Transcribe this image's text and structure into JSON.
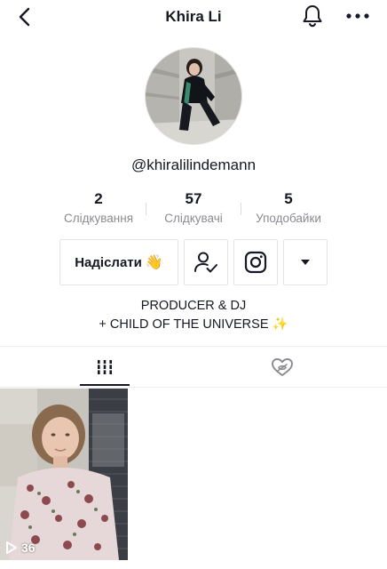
{
  "header": {
    "title": "Khira Li",
    "back_icon": "chevron-left-icon",
    "bell_icon": "bell-icon",
    "more_icon": "more-horizontal-icon"
  },
  "profile": {
    "username": "@khiralilindemann"
  },
  "stats": [
    {
      "value": "2",
      "label": "Слідкування"
    },
    {
      "value": "57",
      "label": "Слідкувачі"
    },
    {
      "value": "5",
      "label": "Уподобайки"
    }
  ],
  "actions": {
    "send_label": "Надіслати",
    "send_emoji": "👋",
    "follow_icon": "user-check-icon",
    "instagram_icon": "instagram-icon",
    "dropdown_icon": "caret-down-icon"
  },
  "bio": {
    "line1": "PRODUCER & DJ",
    "line2": "+ CHILD OF THE UNIVERSE ✨"
  },
  "tabs": {
    "videos_icon": "grid-bars-icon",
    "liked_icon": "heart-hidden-icon"
  },
  "videos": [
    {
      "views": "36"
    }
  ],
  "colors": {
    "text": "#161823",
    "muted": "#8a8b91",
    "border": "#e3e3e4"
  }
}
